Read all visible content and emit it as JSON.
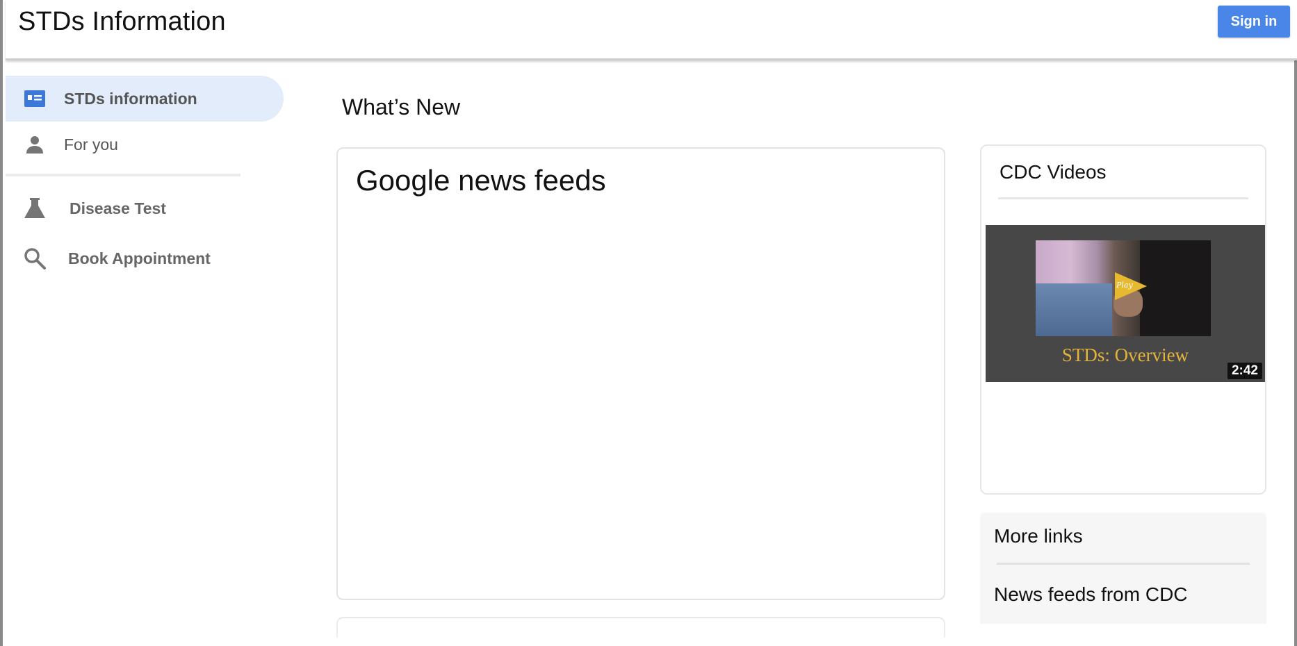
{
  "header": {
    "title": "STDs Information",
    "signin_label": "Sign in",
    "signin_color": "#4a86e8"
  },
  "sidebar": {
    "items": [
      {
        "label": "STDs information",
        "icon": "id-card-icon",
        "active": true
      },
      {
        "label": "For you",
        "icon": "person-icon",
        "active": false
      },
      {
        "label": "Disease Test",
        "icon": "flask-icon",
        "active": false
      },
      {
        "label": "Book Appointment",
        "icon": "search-icon",
        "active": false
      }
    ],
    "active_background": "#e3ecfb"
  },
  "main": {
    "section_title": "What’s New",
    "news_card_title": "Google news feeds"
  },
  "right": {
    "videos_title": "CDC Videos",
    "video": {
      "play_text": "Play",
      "caption": "STDs: Overview",
      "duration": "2:42"
    },
    "more_links_title": "More links",
    "links": [
      "News feeds from CDC"
    ]
  }
}
